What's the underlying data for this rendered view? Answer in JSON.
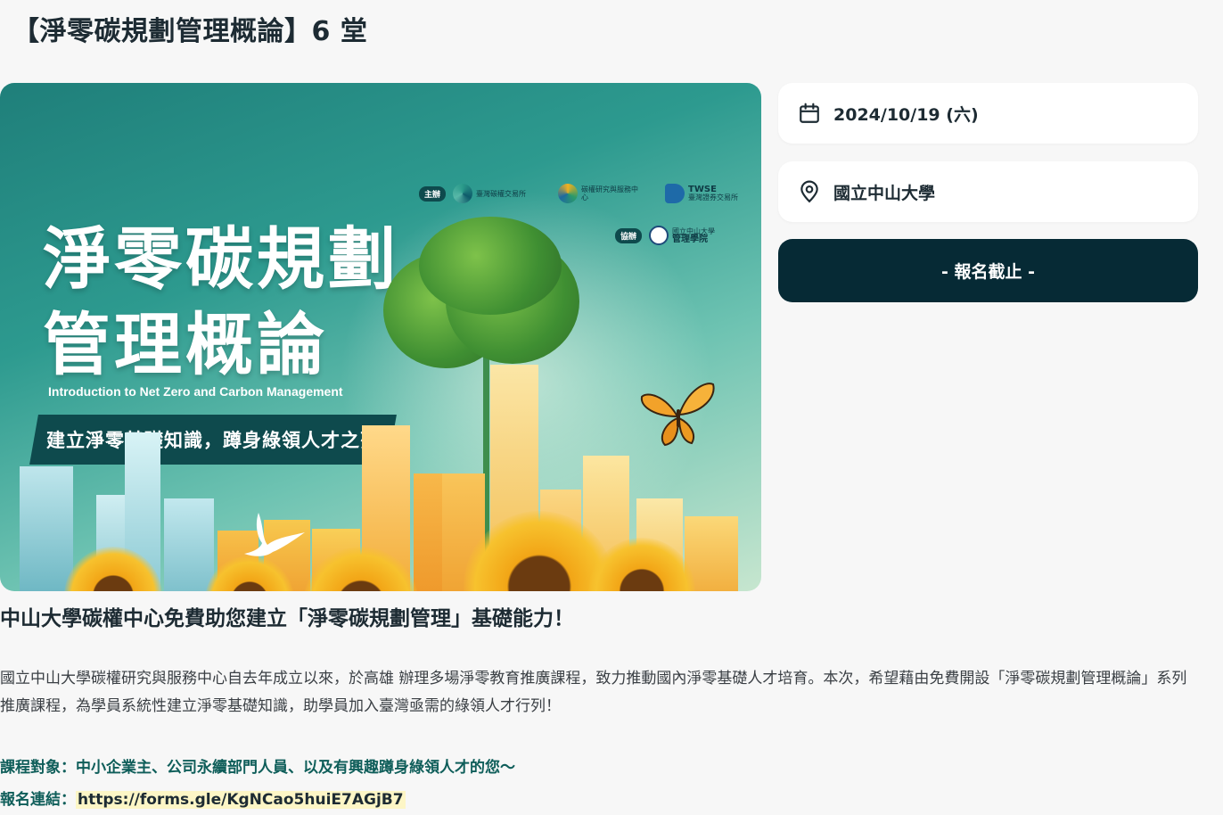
{
  "page": {
    "title": "【淨零碳規劃管理概論】6 堂"
  },
  "banner": {
    "title_line1": "淨零碳規劃",
    "title_line2": "管理概論",
    "subtitle_en": "Introduction to Net Zero and Carbon Management",
    "slogan": "建立淨零基礎知識，蹲身綠領人才之列",
    "host_badge": "主辦",
    "co_badge": "協辦",
    "org1": "臺灣碳權交易所",
    "org2": "碳權研究與服務中心",
    "org3_en": "TWSE",
    "org3": "臺灣證券交易所",
    "org4_top": "國立中山大學",
    "org4": "管理學院",
    "colors": {
      "slogan_bg": "#0e4a4d"
    }
  },
  "event": {
    "date": "2024/10/19 (六)",
    "location": "國立中山大學",
    "date_icon": "calendar-icon",
    "location_icon": "map-pin-icon",
    "register_label": "- 報名截止 -"
  },
  "content": {
    "headline": "中山大學碳權中心免費助您建立「淨零碳規劃管理」基礎能力！",
    "intro": "國立中山大學碳權研究與服務中心自去年成立以來，於高雄 辦理多場淨零教育推廣課程，致力推動國內淨零基礎人才培育。本次，希望藉由免費開設「淨零碳規劃管理概論」系列推廣課程，為學員系統性建立淨零基礎知識，助學員加入臺灣亟需的綠領人才行列！",
    "target": "課程對象：中小企業主、公司永續部門人員、以及有興趣蹲身綠領人才的您～",
    "reg_label": "報名連結：",
    "reg_link": "https://forms.gle/KgNCao5huiE7AGjB7"
  }
}
